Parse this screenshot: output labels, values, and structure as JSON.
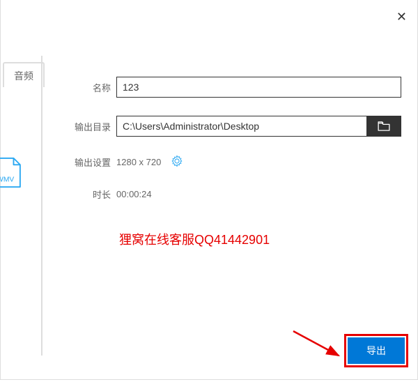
{
  "close_label": "✕",
  "tab_audio": "音频",
  "thumb_format": "WMV",
  "form": {
    "name_label": "名称",
    "name_value": "123",
    "dir_label": "输出目录",
    "dir_value": "C:\\Users\\Administrator\\Desktop",
    "settings_label": "输出设置",
    "settings_value": "1280 x 720",
    "duration_label": "时长",
    "duration_value": "00:00:24"
  },
  "watermark": "狸窝在线客服QQ41442901",
  "export_label": "导出",
  "colors": {
    "accent_blue": "#0078d7",
    "highlight_red": "#e60000",
    "icon_blue": "#2aa8f2"
  }
}
